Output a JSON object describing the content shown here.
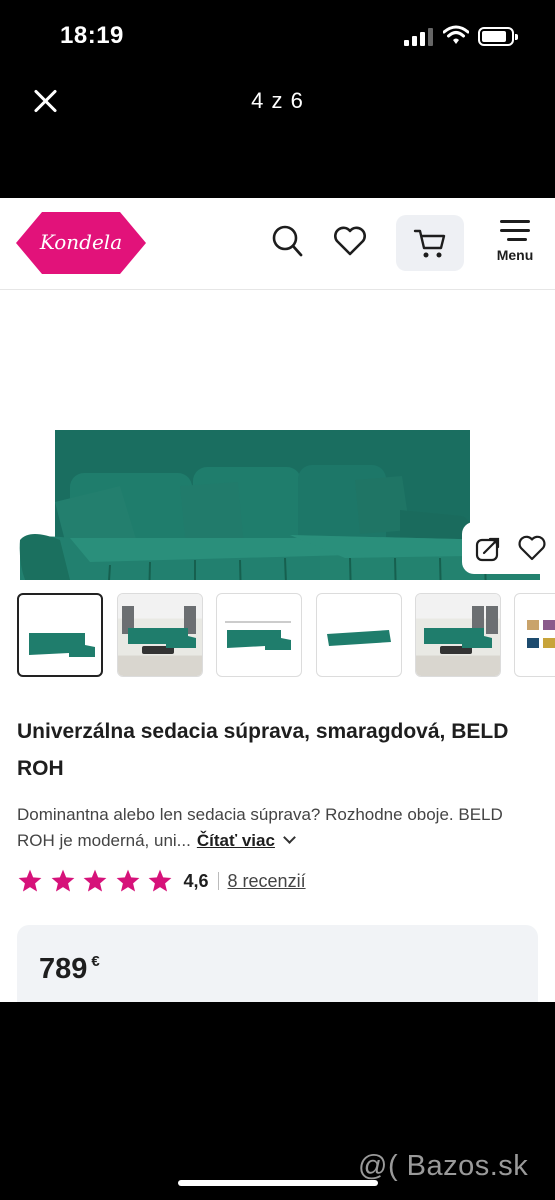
{
  "status_bar": {
    "time": "18:19"
  },
  "viewer": {
    "counter": "4 z 6"
  },
  "site": {
    "logo_text": "Kondela",
    "menu_label": "Menu"
  },
  "product": {
    "title": "Univerzálna sedacia súprava, smaragdová, BELD ROH",
    "description": "Dominantna alebo len sedacia súprava? Rozhodne oboje. BELD ROH je moderná, uni...",
    "read_more": "Čítať viac",
    "rating": "4,6",
    "reviews": "8 recenzií",
    "stars_filled": 5,
    "price": "789",
    "currency": "€"
  },
  "watermark": "@( Bazos.sk",
  "colors": {
    "brand": "#e2127a",
    "sofa": "#1f7d6c",
    "star": "#d6127a"
  }
}
